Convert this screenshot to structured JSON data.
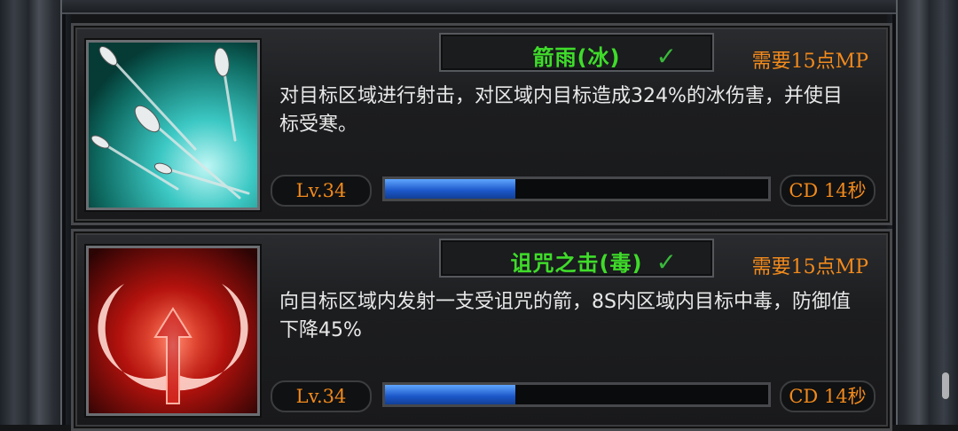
{
  "skills": [
    {
      "name": "箭雨(冰)",
      "mp": "需要15点MP",
      "description": "对目标区域进行射击，对区域内目标造成324%的冰伤害，并使目标受寒。",
      "level": "Lv.34",
      "cooldown": "CD 14秒",
      "progress": 0.34,
      "selected": true,
      "icon": "arrow-rain-icon"
    },
    {
      "name": "诅咒之击(毒)",
      "mp": "需要15点MP",
      "description": "向目标区域内发射一支受诅咒的箭，8S内区域内目标中毒，防御值下降45%",
      "level": "Lv.34",
      "cooldown": "CD 14秒",
      "progress": 0.34,
      "selected": true,
      "icon": "cursed-arrow-icon"
    }
  ],
  "colors": {
    "title": "#3fdc2a",
    "accent": "#f28a1c",
    "bar": "#1b56c8"
  }
}
